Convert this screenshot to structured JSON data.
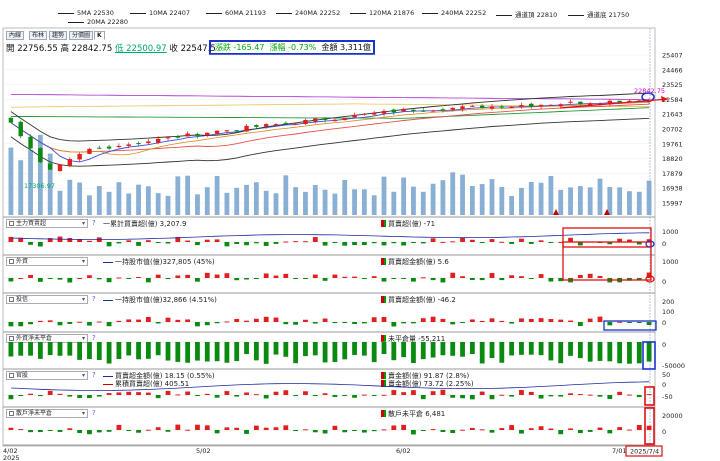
{
  "legend": [
    {
      "label": "5MA 22530",
      "color": "#3b4fd8"
    },
    {
      "label": "10MA 22407",
      "color": "#d98a1e"
    },
    {
      "label": "60MA 21193",
      "color": "#1e9a3a"
    },
    {
      "label": "240MA 22252",
      "color": "#e0201e"
    },
    {
      "label": "120MA 21876",
      "color": "#e8c25a"
    },
    {
      "label": "240MA 22252",
      "color": "#a52ad0"
    },
    {
      "label": "通道頂 22810",
      "color": "#333333"
    },
    {
      "label": "通道底 21750",
      "color": "#333333"
    },
    {
      "label": "20MA 22280",
      "color": "#e8504a"
    }
  ],
  "tabs": [
    "內線",
    "布林",
    "趨勢",
    "分價圖",
    "K"
  ],
  "ohlc": {
    "open": "開 22756.55",
    "high": "高 22842.75",
    "low": "低 22500.97",
    "close": "收 22547.5"
  },
  "change_box": {
    "change": "漲跌 -165.47",
    "pct": "漲幅 -0.73%",
    "amount": "金額 3,311億"
  },
  "price_labels": {
    "max": "22842.75",
    "min": "17306.97"
  },
  "colors": {
    "up": "#e0201e",
    "down": "#0b8a12",
    "volume": "#8aafd4",
    "highlight_red": "#e01010",
    "highlight_blue": "#1a33c8"
  },
  "panels": [
    {
      "dropdown": "主力買賣超",
      "help": "?",
      "left_text": "一累計買賣超(億) 3,207.9",
      "right_text": "買賣超(億) -71",
      "axis": [
        "1000",
        "0"
      ]
    },
    {
      "dropdown": "外資",
      "left_text": "一持股市值(億)327,805 (45%)",
      "right_text": "買賣超金額(億) 5.6",
      "axis": [
        "1000",
        "0"
      ]
    },
    {
      "dropdown": "投信",
      "help": "?",
      "left_text": "一持股市值(億)32,866 (4.51%)",
      "right_text": "買賣超金額(億) -46.2",
      "axis": [
        "200",
        "100",
        "0"
      ]
    },
    {
      "dropdown": "外資淨未平倉",
      "help": "?",
      "right_text": "未平倉量 -55,211",
      "axis": [
        "0",
        "-50000"
      ]
    },
    {
      "dropdown": "官股",
      "help": "?",
      "left_text": "買賣超金額(億) 18.15 (0.55%)",
      "left_text2": "累積買賣超(億) 405.51",
      "right_text": "賣金額(億) 91.87 (2.8%)",
      "right_text2": "賣金額(億) 73.72 (2.25%)",
      "axis": [
        "50",
        "0",
        "-50"
      ]
    },
    {
      "dropdown": "散戶淨未平倉",
      "help": "?",
      "right_text": "散戶未平倉 6,481",
      "axis": [
        "20000",
        "0"
      ]
    }
  ],
  "price_axis": [
    "25407",
    "24466",
    "23525",
    "22584",
    "21643",
    "20702",
    "19761",
    "18820",
    "17879",
    "16938",
    "15997"
  ],
  "x_axis": [
    {
      "label": "4/02",
      "sub": "2025"
    },
    {
      "label": "5/02",
      "sub": ""
    },
    {
      "label": "6/02",
      "sub": ""
    },
    {
      "label": "7/01",
      "sub": ""
    },
    {
      "label": "2025/7/4",
      "sub": ""
    }
  ]
}
